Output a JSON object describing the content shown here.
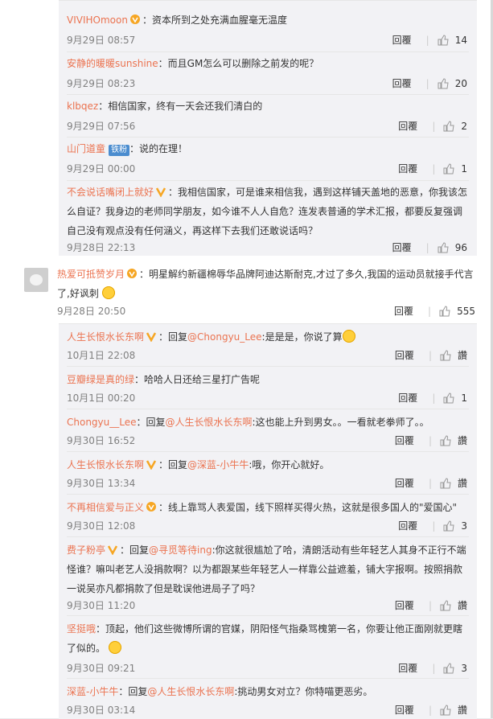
{
  "top_comments": [
    {
      "name": "VIVIHOmoon",
      "badge": "",
      "text": "：资本所到之处充满血腥毫无温度",
      "time": "9月29日 08:57",
      "reply": "回覆",
      "likes": "14"
    },
    {
      "name": "安静的暖暖sunshine",
      "badge": "",
      "text": "：而且GM怎么可以删除之前发的呢？",
      "time": "9月29日 08:23",
      "reply": "回覆",
      "likes": "20"
    },
    {
      "name": "klbqez",
      "badge": "",
      "text": "：相信国家，终有一天会还我们清白的",
      "time": "9月29日 07:56",
      "reply": "回覆",
      "likes": "2"
    },
    {
      "name": "山门道童",
      "badge": "铁粉",
      "text": "：说的在理！",
      "time": "9月29日 00:00",
      "reply": "回覆",
      "likes": "1"
    },
    {
      "name": "不会说话嘴闭上就好",
      "badge": "",
      "text": "：我相信国家，可是谁来相信我，遇到这样铺天盖地的恶意，你我该怎么自证？我身边的老师同学朋友，如今谁不人人自危？连发表普通的学术汇报，都要反复强调自己没有观点没有任何涵义，再这样下去我们还敢说话吗？",
      "time": "9月28日 22:13",
      "reply": "回覆",
      "likes": "96"
    }
  ],
  "main_comment": {
    "name": "热爱可抵赞岁月",
    "text": "：明星解约新疆棉辱华品牌阿迪达斯耐克,才过了多久,我国的运动员就接手代言了,好讽刺",
    "time": "9月28日 20:50",
    "reply": "回覆",
    "likes": "555"
  },
  "replies": [
    {
      "name": "人生长恨水长东啊",
      "mention": "@Chongyu_Lee",
      "pre": "：回复",
      "text": ":是是是，你说了算",
      "time": "10月1日 22:08",
      "reply": "回覆",
      "likes": "讚"
    },
    {
      "name": "豆瓣绿是真的绿",
      "mention": "",
      "pre": "",
      "text": "：哈哈人日还给三星打广告呢",
      "time": "10月1日 00:20",
      "reply": "回覆",
      "likes": "1"
    },
    {
      "name": "Chongyu__Lee",
      "mention": "@人生长恨水长东啊",
      "pre": "：回复",
      "text": ":这也能上升到男女。。一看就老拳师了。。",
      "time": "9月30日 16:52",
      "reply": "回覆",
      "likes": "讚"
    },
    {
      "name": "人生长恨水长东啊",
      "mention": "@深蓝-小牛牛",
      "pre": "：回复",
      "text": ":哦，你开心就好。",
      "time": "9月30日 13:34",
      "reply": "回覆",
      "likes": "讚"
    },
    {
      "name": "不再相信爱与正义",
      "mention": "",
      "pre": "",
      "text": "：线上靠骂人表爱国，线下照样买得火热，这就是很多国人的\"爱国心\"",
      "time": "9月30日 12:08",
      "reply": "回覆",
      "likes": "3"
    },
    {
      "name": "费子粉亭",
      "mention": "@寻觅等待ing",
      "pre": "：回复",
      "text": ":你这就很尴尬了哈，清朗活动有些年轻艺人其身不正行不端怪谁？嘛叫老艺人没捐款啊？以为都跟某些年轻艺人一样靠公益遮羞，铺大字报啊。按照捐款一说吴亦凡都捐款了但是耽误他进局子了吗？",
      "time": "9月30日 11:20",
      "reply": "回覆",
      "likes": "讚"
    },
    {
      "name": "坚挺哦",
      "mention": "",
      "pre": "",
      "text": "：顶起，他们这些微博所谓的官媒，阴阳怪气指桑骂槐第一名，你要让他正面刚就更瞎了似的。",
      "time": "9月30日 09:21",
      "reply": "回覆",
      "likes": "3"
    },
    {
      "name": "深蓝-小牛牛",
      "mention": "@人生长恨水长东啊",
      "pre": "：回复",
      "text": ":挑动男女对立？你特喵更恶劣。",
      "time": "9月30日 03:14",
      "reply": "回覆",
      "likes": "讚"
    }
  ],
  "colors": {
    "name": "#eb7350",
    "mention": "#eb7350",
    "time": "#808080",
    "bg_sub": "#f2f2f5"
  },
  "icons": {
    "like": "thumb-up-icon",
    "vip": "vip-icon",
    "emoji": "smile-emoji-icon"
  }
}
